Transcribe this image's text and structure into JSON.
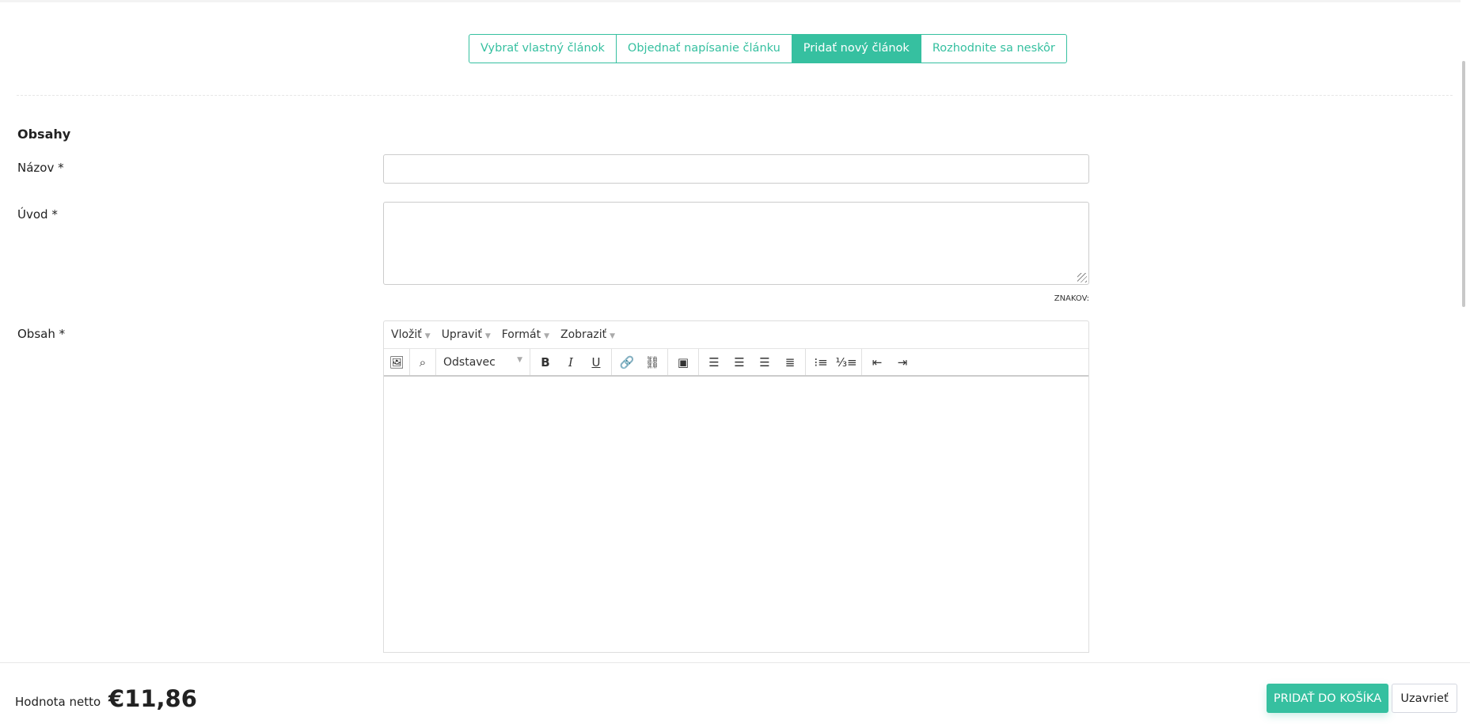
{
  "tabs": [
    {
      "label": "Vybrať vlastný článok",
      "active": false
    },
    {
      "label": "Objednať napísanie článku",
      "active": false
    },
    {
      "label": "Pridať nový článok",
      "active": true
    },
    {
      "label": "Rozhodnite sa neskôr",
      "active": false
    }
  ],
  "form": {
    "section": "Obsahy",
    "title_label": "Názov *",
    "title_value": "",
    "intro_label": "Úvod *",
    "intro_value": "",
    "counter": "ZNAKOV:",
    "content_label": "Obsah *"
  },
  "editor": {
    "menus": [
      "Vložiť",
      "Upraviť",
      "Formát",
      "Zobraziť"
    ],
    "format_select": "Odstavec"
  },
  "footer": {
    "net_label": "Hodnota netto",
    "price": "€11,86",
    "add_to_cart": "PRIDAŤ DO KOŠÍKA",
    "close": "Uzavrieť"
  },
  "colors": {
    "accent": "#36c0a0"
  }
}
